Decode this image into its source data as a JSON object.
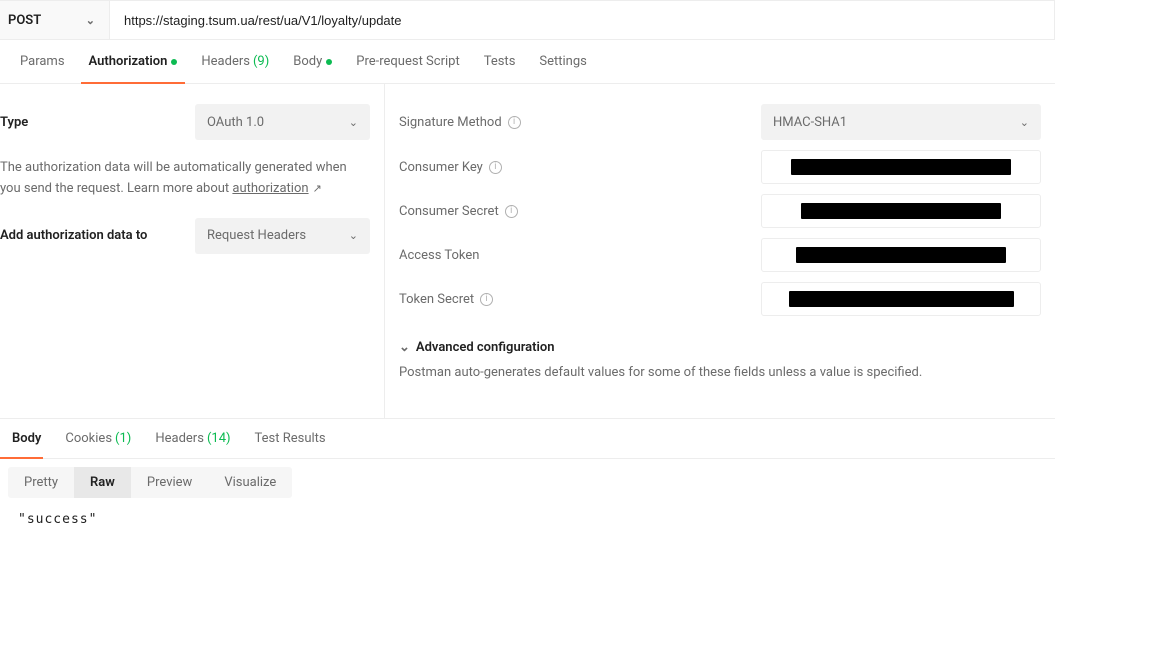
{
  "request": {
    "method": "POST",
    "url": "https://staging.tsum.ua/rest/ua/V1/loyalty/update"
  },
  "tabs": {
    "params": "Params",
    "authorization": "Authorization",
    "headers_label": "Headers",
    "headers_count": "(9)",
    "body": "Body",
    "pre_request": "Pre-request Script",
    "tests": "Tests",
    "settings": "Settings",
    "active": "authorization"
  },
  "auth": {
    "type_label": "Type",
    "type_value": "OAuth 1.0",
    "help_text_1": "The authorization data will be automatically generated when you send the request. Learn more about ",
    "help_link": "authorization",
    "add_to_label": "Add authorization data to",
    "add_to_value": "Request Headers",
    "signature_method_label": "Signature Method",
    "signature_method_value": "HMAC-SHA1",
    "consumer_key_label": "Consumer Key",
    "consumer_secret_label": "Consumer Secret",
    "access_token_label": "Access Token",
    "token_secret_label": "Token Secret",
    "advanced_label": "Advanced configuration",
    "advanced_note": "Postman auto-generates default values for some of these fields unless a value is specified."
  },
  "response": {
    "tabs": {
      "body": "Body",
      "cookies": "Cookies",
      "cookies_count": "(1)",
      "headers": "Headers",
      "headers_count": "(14)",
      "tests": "Test Results",
      "active": "body"
    },
    "views": {
      "pretty": "Pretty",
      "raw": "Raw",
      "preview": "Preview",
      "visualize": "Visualize",
      "active": "raw"
    },
    "body_text": "\"success\""
  }
}
